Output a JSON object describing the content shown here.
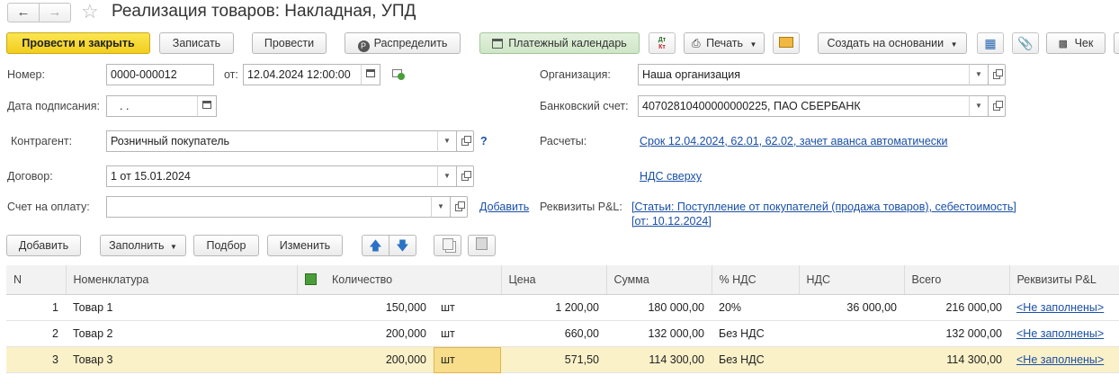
{
  "window": {
    "title": "Реализация товаров: Накладная, УПД"
  },
  "toolbar": {
    "post_close": "Провести и закрыть",
    "save": "Записать",
    "post": "Провести",
    "distribute": "Распределить",
    "calendar": "Платежный календарь",
    "dt_kt": "Дт Кт",
    "print": "Печать",
    "create_based": "Создать на основании",
    "check": "Чек"
  },
  "form": {
    "number_label": "Номер:",
    "number_value": "0000-000012",
    "from_label": "от:",
    "date_value": "12.04.2024 12:00:00",
    "sign_date_label": "Дата подписания:",
    "sign_date_value": " .  .",
    "counterparty_label": "Контрагент:",
    "counterparty_value": "Розничный покупатель",
    "help": "?",
    "contract_label": "Договор:",
    "contract_value": "1 от 15.01.2024",
    "invoice_label": "Счет на оплату:",
    "invoice_value": "",
    "add_link": "Добавить",
    "org_label": "Организация:",
    "org_value": "Наша организация",
    "bank_label": "Банковский счет:",
    "bank_value": "40702810400000000225, ПАО СБЕРБАНК",
    "settlements_label": "Расчеты:",
    "settlements_value": "Срок 12.04.2024, 62.01, 62.02, зачет аванса автоматически",
    "vat_link": "НДС сверху",
    "pl_label": "Реквизиты P&L:",
    "pl_value_line1": "[Статьи: Поступление от покупателей (продажа товаров), себестоимость]",
    "pl_value_line2": "[от: 10.12.2024]"
  },
  "table_toolbar": {
    "add": "Добавить",
    "fill": "Заполнить",
    "select": "Подбор",
    "change": "Изменить"
  },
  "table": {
    "columns": [
      "N",
      "Номенклатура",
      "",
      "Количество",
      "",
      "Цена",
      "Сумма",
      "% НДС",
      "НДС",
      "Всего",
      "Реквизиты P&L"
    ],
    "rows": [
      {
        "n": "1",
        "name": "Товар 1",
        "qty": "150,000",
        "unit": "шт",
        "price": "1 200,00",
        "sum": "180 000,00",
        "vat_rate": "20%",
        "vat": "36 000,00",
        "total": "216 000,00",
        "pl": "<Не заполнены>"
      },
      {
        "n": "2",
        "name": "Товар 2",
        "qty": "200,000",
        "unit": "шт",
        "price": "660,00",
        "sum": "132 000,00",
        "vat_rate": "Без НДС",
        "vat": "",
        "total": "132 000,00",
        "pl": "<Не заполнены>"
      },
      {
        "n": "3",
        "name": "Товар 3",
        "qty": "200,000",
        "unit": "шт",
        "price": "571,50",
        "sum": "114 300,00",
        "vat_rate": "Без НДС",
        "vat": "",
        "total": "114 300,00",
        "pl": "<Не заполнены>"
      }
    ]
  }
}
